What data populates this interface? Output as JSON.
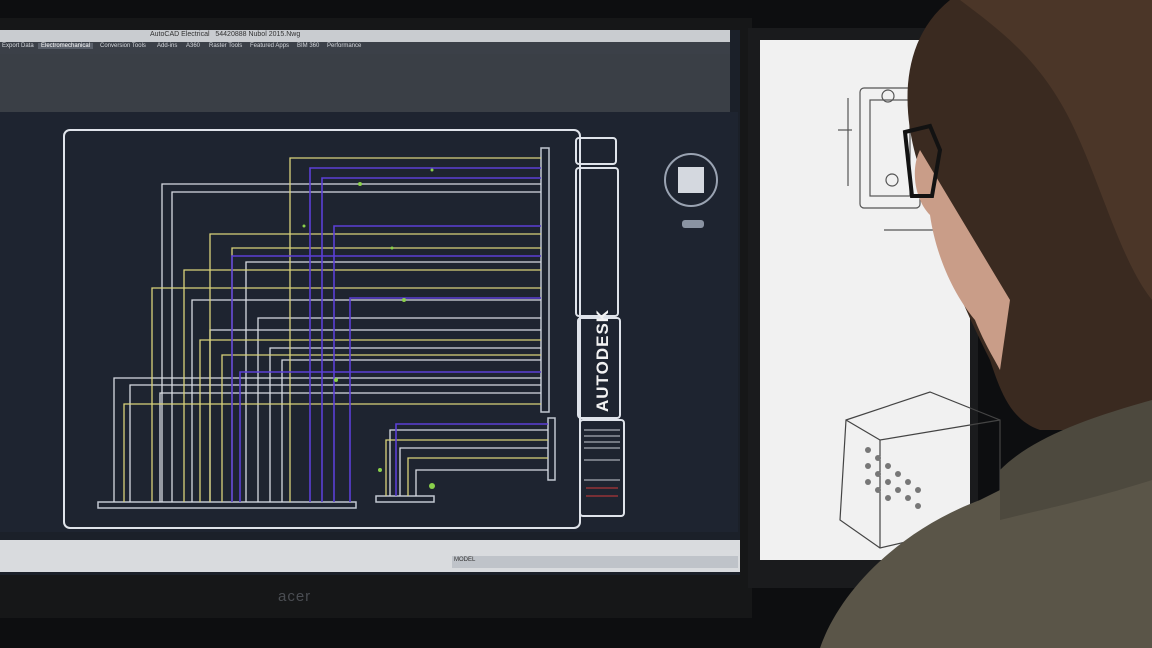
{
  "app": {
    "window_title": "AutoCAD Electrical",
    "file_name": "54420888 Nubol  2015.Nwg"
  },
  "ribbon": {
    "tabs": [
      "Export Data",
      "Electromechanical",
      "Conversion Tools",
      "Add-ins",
      "A360",
      "Raster Tools",
      "Featured Apps",
      "BIM 360",
      "Performance"
    ],
    "active_tab": "Electromechanical"
  },
  "title_block": {
    "brand": "AUTODESK"
  },
  "status": {
    "model_label": "MODEL"
  },
  "monitor": {
    "brand": "acer"
  },
  "colors": {
    "wire_yellow": "#d9d27a",
    "wire_purple": "#5b3fd6",
    "wire_white": "#d8dbe2",
    "wire_green": "#8ad04b",
    "canvas": "#1e2430"
  },
  "icons": {
    "viewcube": "viewcube-icon",
    "navigation": "nav-icon"
  }
}
